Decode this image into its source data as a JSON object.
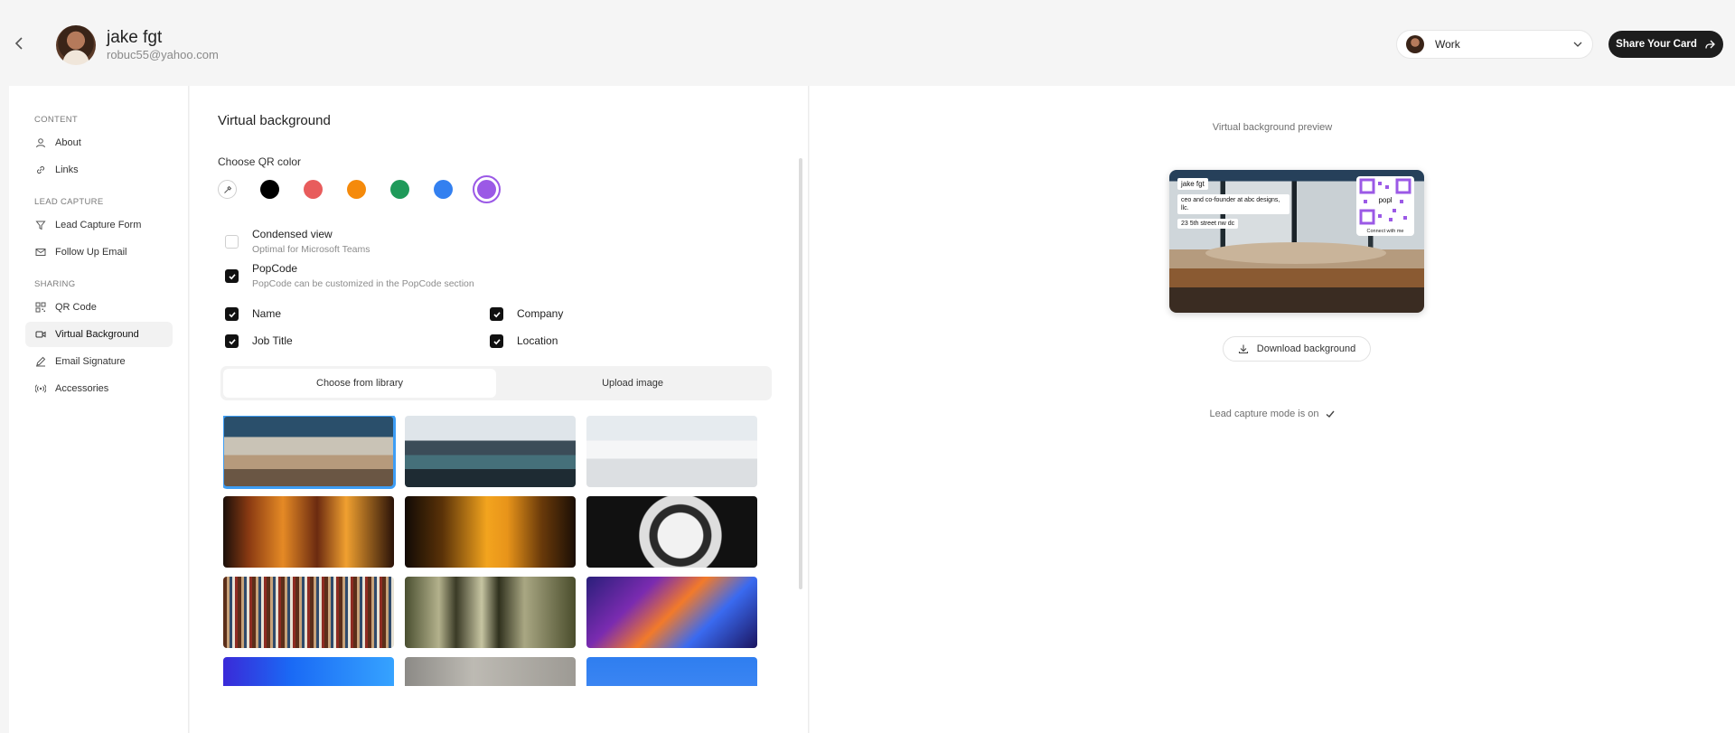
{
  "header": {
    "user_name": "jake fgt",
    "user_email": "robuc55@yahoo.com",
    "card_select": "Work",
    "share_label": "Share Your Card"
  },
  "sidebar": {
    "sections": [
      {
        "label": "CONTENT",
        "items": [
          {
            "label": "About",
            "icon": "user-icon"
          },
          {
            "label": "Links",
            "icon": "link-icon"
          }
        ]
      },
      {
        "label": "LEAD CAPTURE",
        "items": [
          {
            "label": "Lead Capture Form",
            "icon": "filter-icon"
          },
          {
            "label": "Follow Up Email",
            "icon": "mail-icon"
          }
        ]
      },
      {
        "label": "SHARING",
        "items": [
          {
            "label": "QR Code",
            "icon": "qr-code-icon"
          },
          {
            "label": "Virtual Background",
            "icon": "video-icon",
            "active": true
          },
          {
            "label": "Email Signature",
            "icon": "pen-icon"
          },
          {
            "label": "Accessories",
            "icon": "broadcast-icon"
          }
        ]
      }
    ]
  },
  "panel": {
    "title": "Virtual background",
    "qr_color_label": "Choose QR color",
    "colors": [
      "#000000",
      "#e85c5c",
      "#f58a0b",
      "#1f9a5a",
      "#3380f0",
      "#9b59e6"
    ],
    "selected_color": "#9b59e6",
    "condensed": {
      "title": "Condensed view",
      "subtitle": "Optimal for Microsoft Teams",
      "checked": false
    },
    "popcode": {
      "title": "PopCode",
      "subtitle": "PopCode can be customized in the PopCode section",
      "checked": true
    },
    "fields": {
      "name": "Name",
      "company": "Company",
      "job_title": "Job Title",
      "location": "Location"
    },
    "tabs": {
      "library": "Choose from library",
      "upload": "Upload image"
    }
  },
  "preview": {
    "label": "Virtual background preview",
    "card_name": "jake fgt",
    "card_title": "ceo and co-founder at abc designs, llc.",
    "card_location": "23 5th street nw dc",
    "qr_caption": "Connect with me",
    "qr_logo": "popl",
    "download_label": "Download background",
    "lead_note": "Lead capture mode is on"
  },
  "colors": {
    "accent": "#3d9df5",
    "dark": "#1d1d1d"
  }
}
